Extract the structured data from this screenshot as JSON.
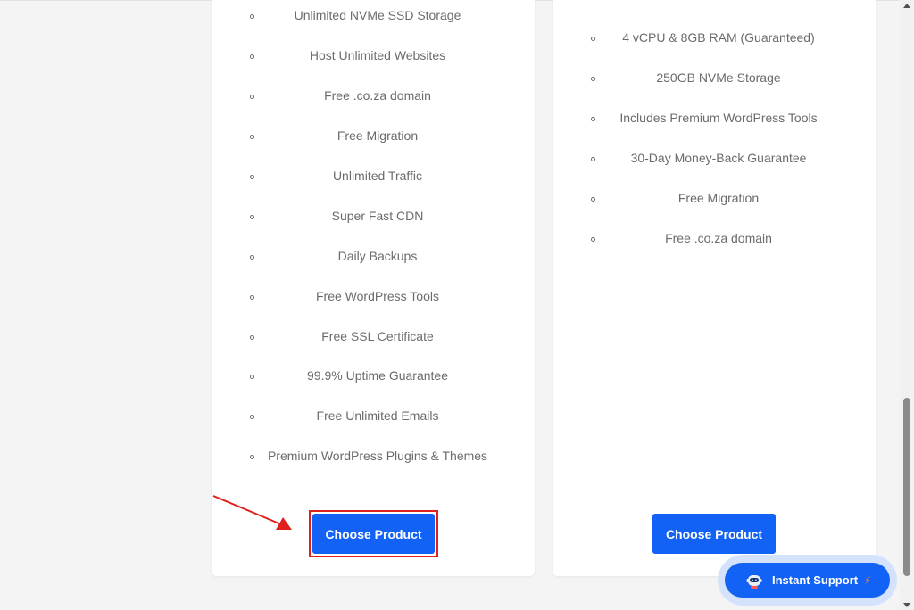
{
  "plans": [
    {
      "features": [
        "Unlimited NVMe SSD Storage",
        "Host Unlimited Websites",
        "Free .co.za domain",
        "Free Migration",
        "Unlimited Traffic",
        "Super Fast CDN",
        "Daily Backups",
        "Free WordPress Tools",
        "Free SSL Certificate",
        "99.9% Uptime Guarantee",
        "Free Unlimited Emails",
        "Premium WordPress Plugins & Themes"
      ],
      "button_label": "Choose Product"
    },
    {
      "features": [
        "4 vCPU & 8GB RAM (Guaranteed)",
        "250GB NVMe Storage",
        "Includes Premium WordPress Tools",
        "30-Day Money-Back Guarantee",
        "Free Migration",
        "Free .co.za domain"
      ],
      "button_label": "Choose Product"
    }
  ],
  "support": {
    "label": "Instant Support",
    "icon": "robot-icon",
    "badge_icon": "bolt-icon"
  },
  "colors": {
    "primary": "#1263f5",
    "highlight": "#e0201c",
    "support_glow": "#d4e3fb",
    "bolt": "#ff7a3d"
  }
}
